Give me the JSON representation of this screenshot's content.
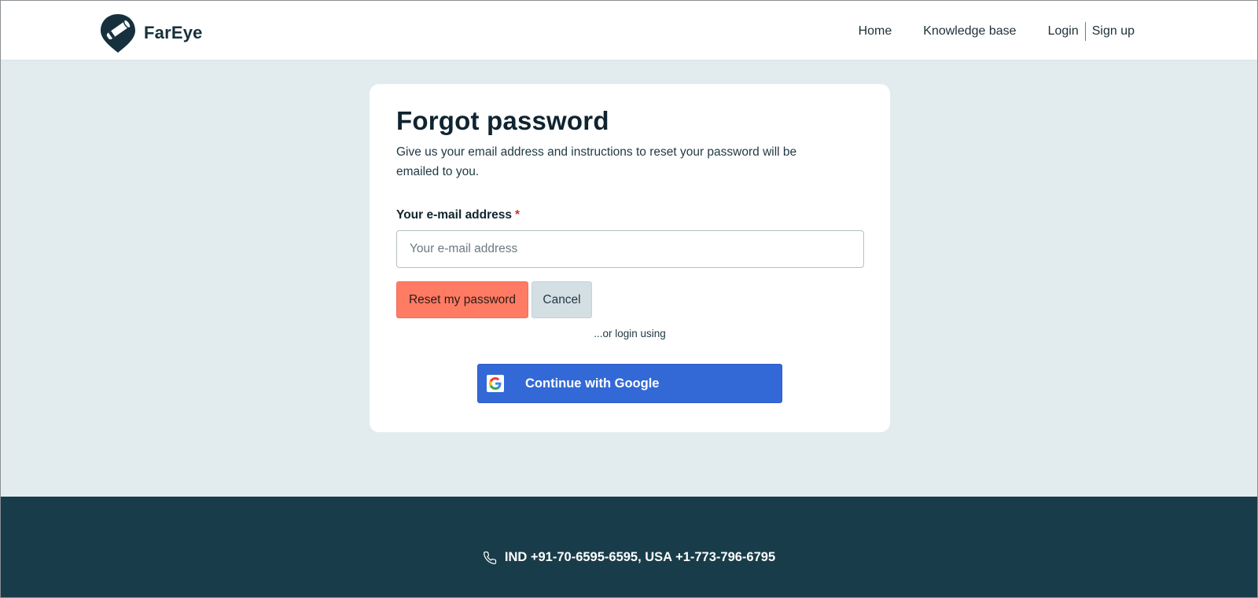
{
  "header": {
    "logo_text": "FarEye",
    "nav": {
      "home": "Home",
      "knowledge_base": "Knowledge base",
      "login": "Login",
      "signup": "Sign up"
    }
  },
  "card": {
    "title": "Forgot password",
    "description": "Give us your email address and instructions to reset your password will be emailed to you.",
    "email_label": "Your e-mail address",
    "required_marker": "*",
    "email_placeholder": "Your e-mail address",
    "email_value": "",
    "reset_button": "Reset my password",
    "cancel_button": "Cancel",
    "or_text": "...or login using",
    "google_button": "Continue with Google"
  },
  "footer": {
    "contact": "IND +91-70-6595-6595, USA +1-773-796-6795"
  },
  "icons": {
    "logo": "fareye-logo-icon",
    "google": "google-icon",
    "phone": "phone-icon"
  },
  "colors": {
    "background": "#e2ecee",
    "primary_button": "#ff7b63",
    "google_button": "#3369d6",
    "footer": "#193c4a"
  }
}
